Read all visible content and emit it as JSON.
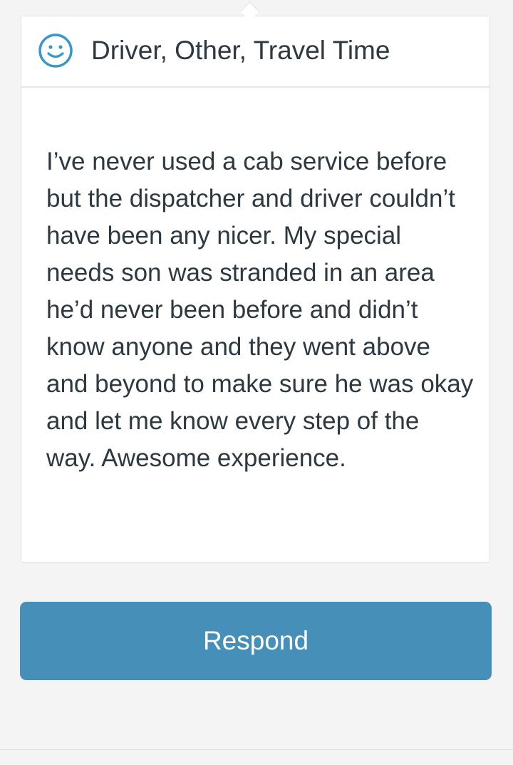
{
  "review": {
    "sentiment_icon": "smiley-face-icon",
    "title": "Driver, Other, Travel Time",
    "text": "I’ve never used a cab service before but the dispatcher and driver couldn’t have been any nicer. My special needs son was stranded in an area he’d never been before and didn’t know anyone and they went above and beyond to make sure he was okay and let me know every step of the way. Awesome experience."
  },
  "actions": {
    "respond_label": "Respond"
  },
  "colors": {
    "accent": "#468fb9",
    "icon": "#3a98c8",
    "text": "#2d3940",
    "background": "#f4f4f4",
    "card": "#ffffff"
  }
}
